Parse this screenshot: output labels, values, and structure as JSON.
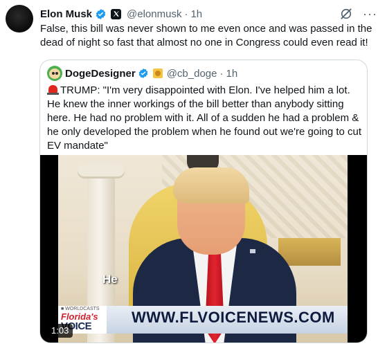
{
  "tweet": {
    "author_name": "Elon Musk",
    "handle": "@elonmusk",
    "dot": "·",
    "time": "1h",
    "text": "False, this bill was never shown to me even once and was passed in the dead of night so fast that almost no one in Congress could even read it!",
    "more_label": "···",
    "icons": [
      "verified-icon",
      "x-affiliate-icon",
      "grok-icon",
      "more-icon"
    ]
  },
  "quote": {
    "author_name": "DogeDesigner",
    "handle": "@cb_doge",
    "dot": "·",
    "time": "1h",
    "text": "TRUMP: \"I'm very disappointed with Elon. I've helped him a lot. He knew the inner workings of the bill better than anybody sitting here. He had no problem with it. All of a sudden he had a problem & he only developed the problem when he found out we're going to cut EV mandate\"",
    "icons": [
      "verified-icon",
      "doge-badge-icon",
      "siren-icon"
    ]
  },
  "video": {
    "caption": "He",
    "timer": "1:03",
    "lower_third": {
      "brand_top": "■ WORLDCASTS",
      "brand_name": "Florida's",
      "brand_voice": "VOICE",
      "url": "WWW.FLVOICENEWS.COM"
    }
  },
  "colors": {
    "text": "#0f1419",
    "secondary_text": "#536471",
    "verified_blue": "#1d9bf0",
    "border": "#cfd9de",
    "tie_red": "#e2232f"
  }
}
